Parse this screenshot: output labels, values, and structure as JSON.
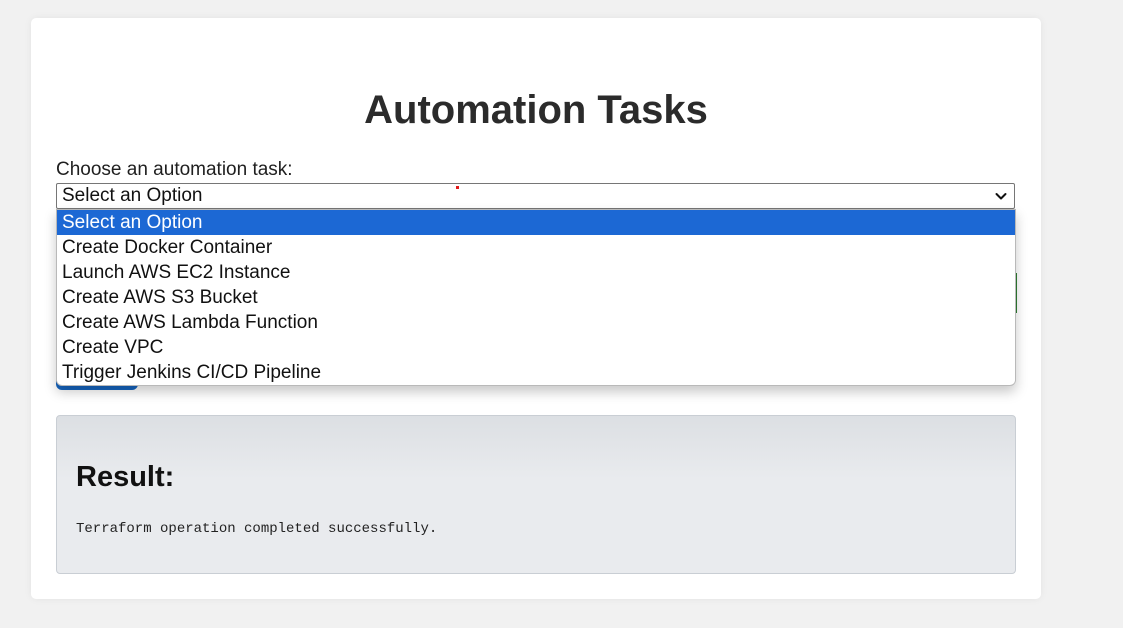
{
  "page": {
    "title": "Automation Tasks",
    "task_label": "Choose an automation task:"
  },
  "select": {
    "selected_value": "Select an Option",
    "options": [
      "Select an Option",
      "Create Docker Container",
      "Launch AWS EC2 Instance",
      "Create AWS S3 Bucket",
      "Create AWS Lambda Function",
      "Create VPC",
      "Trigger Jenkins CI/CD Pipeline"
    ]
  },
  "result": {
    "heading": "Result:",
    "message": "Terraform operation completed successfully."
  },
  "colors": {
    "highlight": "#1c68d4",
    "button_blue": "#1565c0",
    "button_green": "#2e7d32",
    "background": "#f1f1f1"
  }
}
